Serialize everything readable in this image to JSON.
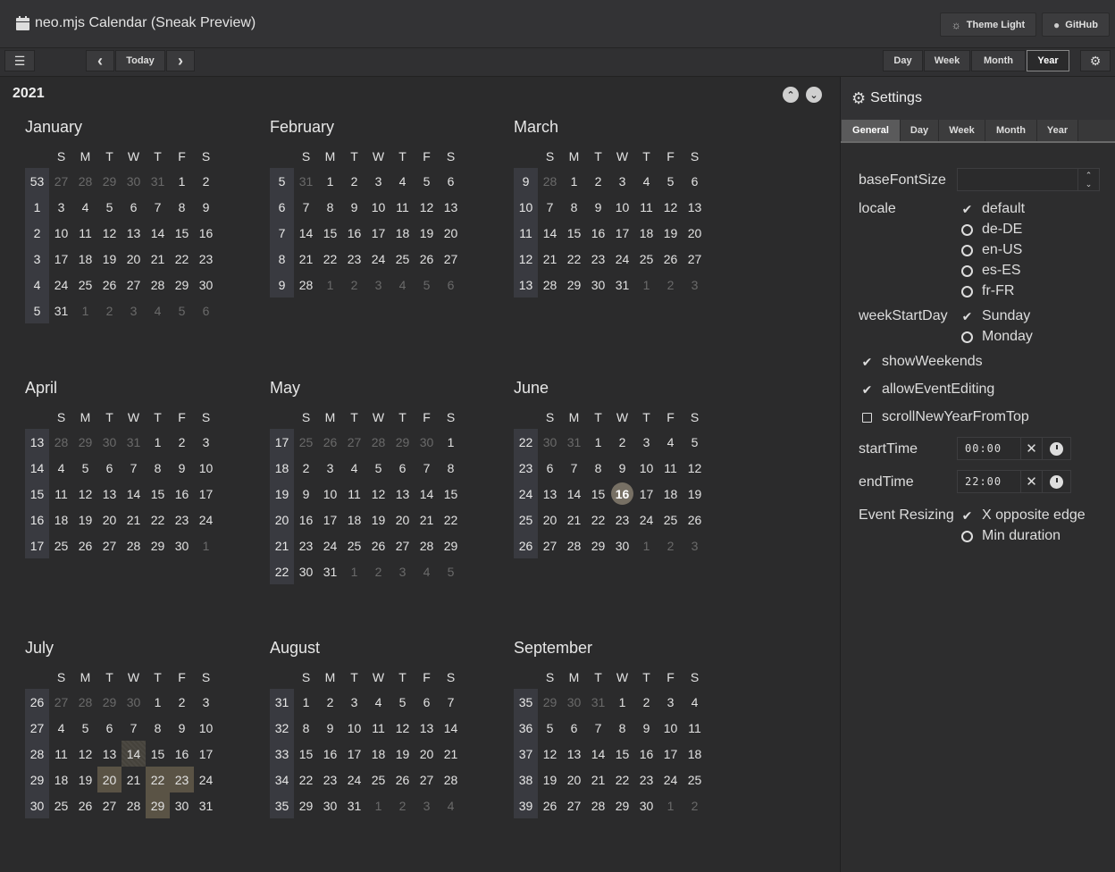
{
  "header": {
    "title": "neo.mjs Calendar (Sneak Preview)",
    "theme_button": "Theme Light",
    "github_button": "GitHub"
  },
  "toolbar": {
    "menu_icon": "☰",
    "prev_icon": "‹",
    "today_label": "Today",
    "next_icon": "›",
    "views": [
      "Day",
      "Week",
      "Month",
      "Year"
    ],
    "active_view": "Year",
    "settings_icon": "⚙"
  },
  "year": {
    "title": "2021",
    "day_headers": [
      "S",
      "M",
      "T",
      "W",
      "T",
      "F",
      "S"
    ],
    "months": [
      {
        "name": "January",
        "weeks": [
          [
            "53",
            "27",
            "28",
            "29",
            "30",
            "31",
            "1",
            "2"
          ],
          [
            "1",
            "3",
            "4",
            "5",
            "6",
            "7",
            "8",
            "9"
          ],
          [
            "2",
            "10",
            "11",
            "12",
            "13",
            "14",
            "15",
            "16"
          ],
          [
            "3",
            "17",
            "18",
            "19",
            "20",
            "21",
            "22",
            "23"
          ],
          [
            "4",
            "24",
            "25",
            "26",
            "27",
            "28",
            "29",
            "30"
          ],
          [
            "5",
            "31",
            "1",
            "2",
            "3",
            "4",
            "5",
            "6"
          ]
        ]
      },
      {
        "name": "February",
        "weeks": [
          [
            "5",
            "31",
            "1",
            "2",
            "3",
            "4",
            "5",
            "6"
          ],
          [
            "6",
            "7",
            "8",
            "9",
            "10",
            "11",
            "12",
            "13"
          ],
          [
            "7",
            "14",
            "15",
            "16",
            "17",
            "18",
            "19",
            "20"
          ],
          [
            "8",
            "21",
            "22",
            "23",
            "24",
            "25",
            "26",
            "27"
          ],
          [
            "9",
            "28",
            "1",
            "2",
            "3",
            "4",
            "5",
            "6"
          ]
        ]
      },
      {
        "name": "March",
        "weeks": [
          [
            "9",
            "28",
            "1",
            "2",
            "3",
            "4",
            "5",
            "6"
          ],
          [
            "10",
            "7",
            "8",
            "9",
            "10",
            "11",
            "12",
            "13"
          ],
          [
            "11",
            "14",
            "15",
            "16",
            "17",
            "18",
            "19",
            "20"
          ],
          [
            "12",
            "21",
            "22",
            "23",
            "24",
            "25",
            "26",
            "27"
          ],
          [
            "13",
            "28",
            "29",
            "30",
            "31",
            "1",
            "2",
            "3"
          ]
        ]
      },
      {
        "name": "April",
        "weeks": [
          [
            "13",
            "28",
            "29",
            "30",
            "31",
            "1",
            "2",
            "3"
          ],
          [
            "14",
            "4",
            "5",
            "6",
            "7",
            "8",
            "9",
            "10"
          ],
          [
            "15",
            "11",
            "12",
            "13",
            "14",
            "15",
            "16",
            "17"
          ],
          [
            "16",
            "18",
            "19",
            "20",
            "21",
            "22",
            "23",
            "24"
          ],
          [
            "17",
            "25",
            "26",
            "27",
            "28",
            "29",
            "30",
            "1"
          ]
        ]
      },
      {
        "name": "May",
        "weeks": [
          [
            "17",
            "25",
            "26",
            "27",
            "28",
            "29",
            "30",
            "1"
          ],
          [
            "18",
            "2",
            "3",
            "4",
            "5",
            "6",
            "7",
            "8"
          ],
          [
            "19",
            "9",
            "10",
            "11",
            "12",
            "13",
            "14",
            "15"
          ],
          [
            "20",
            "16",
            "17",
            "18",
            "19",
            "20",
            "21",
            "22"
          ],
          [
            "21",
            "23",
            "24",
            "25",
            "26",
            "27",
            "28",
            "29"
          ],
          [
            "22",
            "30",
            "31",
            "1",
            "2",
            "3",
            "4",
            "5"
          ]
        ]
      },
      {
        "name": "June",
        "weeks": [
          [
            "22",
            "30",
            "31",
            "1",
            "2",
            "3",
            "4",
            "5"
          ],
          [
            "23",
            "6",
            "7",
            "8",
            "9",
            "10",
            "11",
            "12"
          ],
          [
            "24",
            "13",
            "14",
            "15",
            "16",
            "17",
            "18",
            "19"
          ],
          [
            "25",
            "20",
            "21",
            "22",
            "23",
            "24",
            "25",
            "26"
          ],
          [
            "26",
            "27",
            "28",
            "29",
            "30",
            "1",
            "2",
            "3"
          ]
        ]
      },
      {
        "name": "July",
        "weeks": [
          [
            "26",
            "27",
            "28",
            "29",
            "30",
            "1",
            "2",
            "3"
          ],
          [
            "27",
            "4",
            "5",
            "6",
            "7",
            "8",
            "9",
            "10"
          ],
          [
            "28",
            "11",
            "12",
            "13",
            "14",
            "15",
            "16",
            "17"
          ],
          [
            "29",
            "18",
            "19",
            "20",
            "21",
            "22",
            "23",
            "24"
          ],
          [
            "30",
            "25",
            "26",
            "27",
            "28",
            "29",
            "30",
            "31"
          ]
        ]
      },
      {
        "name": "August",
        "weeks": [
          [
            "31",
            "1",
            "2",
            "3",
            "4",
            "5",
            "6",
            "7"
          ],
          [
            "32",
            "8",
            "9",
            "10",
            "11",
            "12",
            "13",
            "14"
          ],
          [
            "33",
            "15",
            "16",
            "17",
            "18",
            "19",
            "20",
            "21"
          ],
          [
            "34",
            "22",
            "23",
            "24",
            "25",
            "26",
            "27",
            "28"
          ],
          [
            "35",
            "29",
            "30",
            "31",
            "1",
            "2",
            "3",
            "4"
          ]
        ]
      },
      {
        "name": "September",
        "weeks": [
          [
            "35",
            "29",
            "30",
            "31",
            "1",
            "2",
            "3",
            "4"
          ],
          [
            "36",
            "5",
            "6",
            "7",
            "8",
            "9",
            "10",
            "11"
          ],
          [
            "37",
            "12",
            "13",
            "14",
            "15",
            "16",
            "17",
            "18"
          ],
          [
            "38",
            "19",
            "20",
            "21",
            "22",
            "23",
            "24",
            "25"
          ],
          [
            "39",
            "26",
            "27",
            "28",
            "29",
            "30",
            "1",
            "2"
          ]
        ]
      }
    ]
  },
  "settings": {
    "title": "Settings",
    "tabs": [
      "General",
      "Day",
      "Week",
      "Month",
      "Year"
    ],
    "active_tab": "General",
    "base_font_size_label": "baseFontSize",
    "base_font_size_value": "",
    "locale_label": "locale",
    "locale_options": [
      "default",
      "de-DE",
      "en-US",
      "es-ES",
      "fr-FR"
    ],
    "locale_selected": "default",
    "week_start_label": "weekStartDay",
    "week_start_options": [
      "Sunday",
      "Monday"
    ],
    "week_start_selected": "Sunday",
    "show_weekends": {
      "label": "showWeekends",
      "checked": true
    },
    "allow_event_editing": {
      "label": "allowEventEditing",
      "checked": true
    },
    "scroll_new_year": {
      "label": "scrollNewYearFromTop",
      "checked": false
    },
    "start_time_label": "startTime",
    "start_time_value": "00:00",
    "end_time_label": "endTime",
    "end_time_value": "22:00",
    "event_resizing_label": "Event Resizing",
    "event_resizing_options": [
      "X opposite edge",
      "Min duration"
    ],
    "event_resizing_selected": "X opposite edge"
  },
  "colors": {
    "background": "#2b2b2c",
    "week_number_bg": "#393a40",
    "event_bg": "#5a5345",
    "today_bg": "#777064"
  }
}
